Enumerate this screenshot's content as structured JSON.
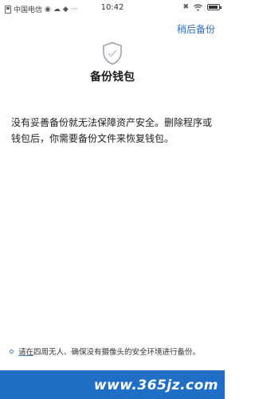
{
  "status_bar": {
    "carrier": "中国电信",
    "time": "10:42",
    "icons": [
      "sim-icon",
      "wechat-icon",
      "cloud-icon",
      "notification-icon",
      "more-icon",
      "mute-icon",
      "wifi-icon",
      "battery-icon"
    ]
  },
  "header": {
    "later_label": "稍后备份"
  },
  "main": {
    "icon": "shield-check-icon",
    "title": "备份钱包",
    "description": "没有妥善备份就无法保障资产安全。删除程序或钱包后，你需要备份文件来恢复钱包。"
  },
  "tip": {
    "prefix": "请",
    "highlight": "在",
    "text": "四周无人、确保没有摄像头的安全环境进行备份。"
  },
  "footer": {
    "watermark": "www.365jz.com"
  },
  "colors": {
    "accent": "#2f6fbf",
    "bottom_bar": "#1f6fc7"
  }
}
